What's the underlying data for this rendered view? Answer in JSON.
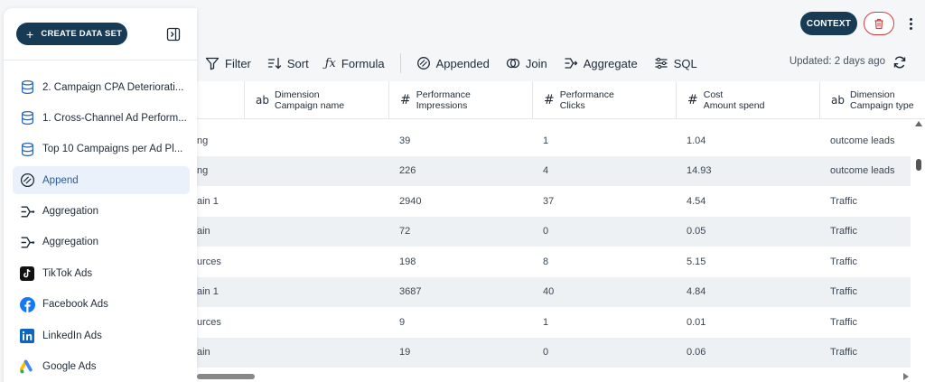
{
  "header": {
    "context_label": "CONTEXT",
    "delete_icon": "trash-icon",
    "more_icon": "more-vertical-icon"
  },
  "sidebar": {
    "create_label": "CREATE DATA SET",
    "items": [
      {
        "label": "2. Campaign CPA Deteriorati...",
        "icon": "database-icon"
      },
      {
        "label": "1. Cross-Channel Ad Perform...",
        "icon": "database-icon"
      },
      {
        "label": "Top 10 Campaigns per Ad Pl...",
        "icon": "database-icon"
      },
      {
        "label": "Append",
        "icon": "append-icon",
        "active": true
      },
      {
        "label": "Aggregation",
        "icon": "aggregate-icon"
      },
      {
        "label": "Aggregation",
        "icon": "aggregate-icon"
      },
      {
        "label": "TikTok Ads",
        "icon": "tiktok-icon"
      },
      {
        "label": "Facebook Ads",
        "icon": "facebook-icon"
      },
      {
        "label": "LinkedIn Ads",
        "icon": "linkedin-icon"
      },
      {
        "label": "Google Ads",
        "icon": "google-ads-icon"
      }
    ]
  },
  "toolbar": {
    "filter": "Filter",
    "sort": "Sort",
    "formula": "Formula",
    "appended": "Appended",
    "join": "Join",
    "aggregate": "Aggregate",
    "sql": "SQL",
    "updated": "Updated: 2 days ago"
  },
  "table": {
    "columns": [
      {
        "type": "ab",
        "line1": "Dimension",
        "line2": "Campaign name"
      },
      {
        "type": "#",
        "line1": "Performance",
        "line2": "Impressions"
      },
      {
        "type": "#",
        "line1": "Performance",
        "line2": "Clicks"
      },
      {
        "type": "#",
        "line1": "Cost",
        "line2": "Amount spend"
      },
      {
        "type": "ab",
        "line1": "Dimension",
        "line2": "Campaign type"
      }
    ],
    "rows": [
      {
        "c0": "ng",
        "c1": "39",
        "c2": "1",
        "c3": "1.04",
        "c4": "outcome leads"
      },
      {
        "c0": "ng",
        "c1": "226",
        "c2": "4",
        "c3": "14.93",
        "c4": "outcome leads"
      },
      {
        "c0": "ain 1",
        "c1": "2940",
        "c2": "37",
        "c3": "4.54",
        "c4": "Traffic"
      },
      {
        "c0": "ain",
        "c1": "72",
        "c2": "0",
        "c3": "0.05",
        "c4": "Traffic"
      },
      {
        "c0": "urces",
        "c1": "198",
        "c2": "8",
        "c3": "5.15",
        "c4": "Traffic"
      },
      {
        "c0": "ain 1",
        "c1": "3687",
        "c2": "40",
        "c3": "4.84",
        "c4": "Traffic"
      },
      {
        "c0": "urces",
        "c1": "9",
        "c2": "1",
        "c3": "0.01",
        "c4": "Traffic"
      },
      {
        "c0": "ain",
        "c1": "19",
        "c2": "0",
        "c3": "0.06",
        "c4": "Traffic"
      }
    ]
  },
  "colors": {
    "primary": "#173a55",
    "danger": "#d23c3c",
    "active_bg": "#eaf1fa"
  }
}
